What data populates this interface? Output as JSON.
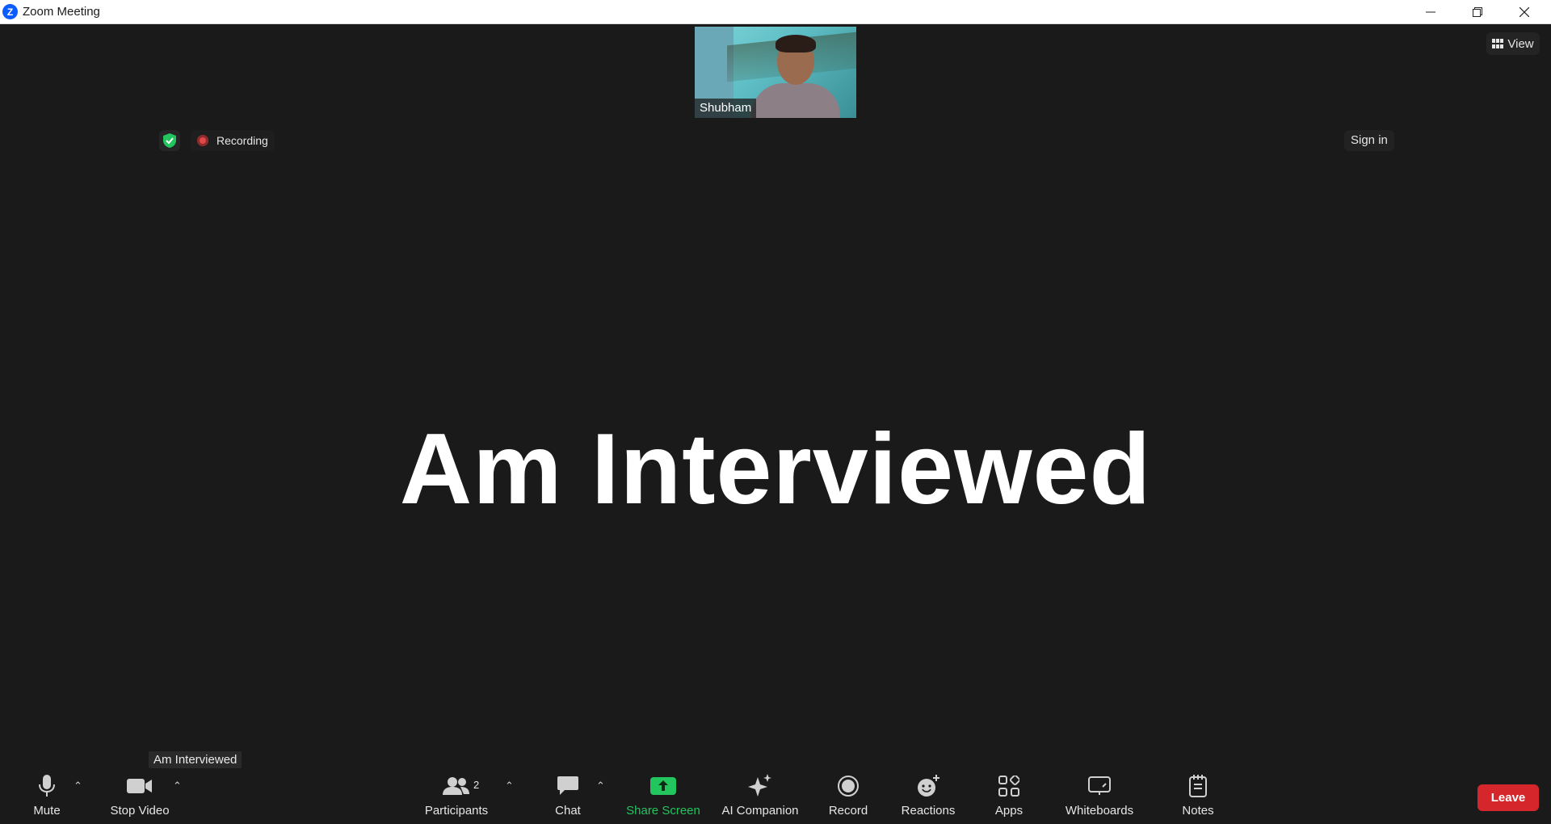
{
  "window": {
    "title": "Zoom Meeting",
    "logo_letter": "Z"
  },
  "video": {
    "self_name": "Shubham"
  },
  "header": {
    "view_label": "View",
    "recording_label": "Recording",
    "signin_label": "Sign in"
  },
  "main": {
    "participant_name": "Am Interviewed",
    "speaker_label": "Am Interviewed"
  },
  "toolbar": {
    "mute": "Mute",
    "stop_video": "Stop Video",
    "participants": "Participants",
    "participants_count": "2",
    "chat": "Chat",
    "share_screen": "Share Screen",
    "ai_companion": "AI Companion",
    "record": "Record",
    "reactions": "Reactions",
    "apps": "Apps",
    "whiteboards": "Whiteboards",
    "notes": "Notes",
    "leave": "Leave"
  },
  "colors": {
    "background": "#1a1a1a",
    "share_green": "#22c55e",
    "leave_red": "#d5262b",
    "zoom_blue": "#0b5cff"
  }
}
